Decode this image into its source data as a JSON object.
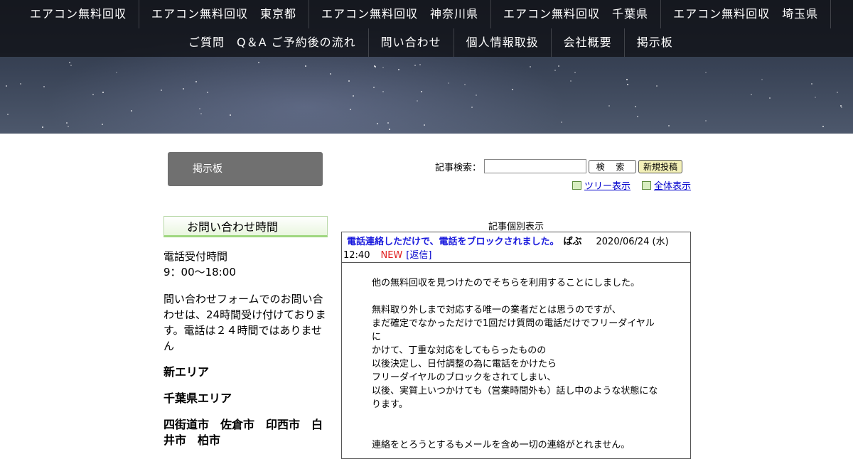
{
  "nav": {
    "row1": [
      "エアコン無料回収",
      "エアコン無料回収　東京都",
      "エアコン無料回収　神奈川県",
      "エアコン無料回収　千葉県",
      "エアコン無料回収　埼玉県"
    ],
    "row2": [
      "ご質問　Q＆A ご予約後の流れ",
      "問い合わせ",
      "個人情報取扱",
      "会社概要",
      "掲示板"
    ]
  },
  "section_tab": "掲示板",
  "search": {
    "label": "記事検索：",
    "value": "",
    "search_button": "検 索",
    "new_post_button": "新規投稿",
    "tree_view": "ツリー表示",
    "all_view": "全体表示"
  },
  "sidebar": {
    "heading": "お問い合わせ時間",
    "phone_hours": "電話受付時間",
    "phone_time": "9：00～18:00",
    "form_note": "問い合わせフォームでのお問い合わせは、24時間受け付けております。電話は２４時間ではありません",
    "new_area": "新エリア",
    "chiba_area": "千葉県エリア",
    "cities": "四街道市　佐倉市　印西市　白井市　柏市"
  },
  "post": {
    "caption": "記事個別表示",
    "title": "電話連絡しただけで、電話をブロックされました。",
    "author": "ぱぶ",
    "date": "2020/06/24 (水)",
    "time": "12:40",
    "new_badge": "NEW",
    "reply": "[返信]",
    "lines": [
      "他の無料回収を見つけたのでそちらを利用することにしました。",
      "",
      "無料取り外しまで対応する唯一の業者だとは思うのですが、",
      "まだ確定でなかっただけで1回だけ質問の電話だけでフリーダイヤル",
      "に",
      "かけて、丁重な対応をしてもらったものの",
      "以後決定し、日付調整の為に電話をかけたら",
      "フリーダイヤルのブロックをされてしまい、",
      "以後、実質上いつかけても（営業時間外も）話し中のような状態にな",
      "ります。",
      "",
      "",
      "連絡をとろうとするもメールを含め一切の連絡がとれません。"
    ]
  }
}
